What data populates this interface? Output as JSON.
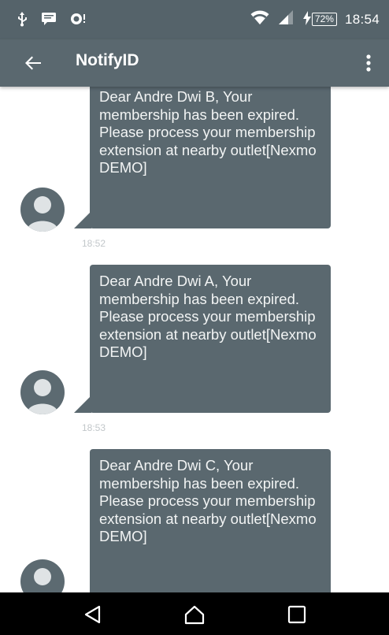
{
  "status_bar": {
    "notification_icons": [
      "usb-icon",
      "chat-icon",
      "alarm-icon"
    ],
    "battery_level": "72%",
    "time": "18:54"
  },
  "app_bar": {
    "title": "NotifyID"
  },
  "messages": [
    {
      "text": "Dear Andre Dwi B, Your membership has been expired. Please process your membership extension at nearby outlet[Nexmo DEMO]",
      "time": "18:52"
    },
    {
      "text": "Dear Andre Dwi A, Your membership has been expired. Please process your membership extension at nearby outlet[Nexmo DEMO]",
      "time": "18:53"
    },
    {
      "text": "Dear Andre Dwi C, Your membership has been expired. Please process your membership extension at nearby outlet[Nexmo DEMO]",
      "time": ""
    }
  ],
  "colors": {
    "bar": "#5a686f",
    "bubble": "#5a686f",
    "bubble_text": "#f2f4f4",
    "timestamp": "#c2c7ca"
  }
}
